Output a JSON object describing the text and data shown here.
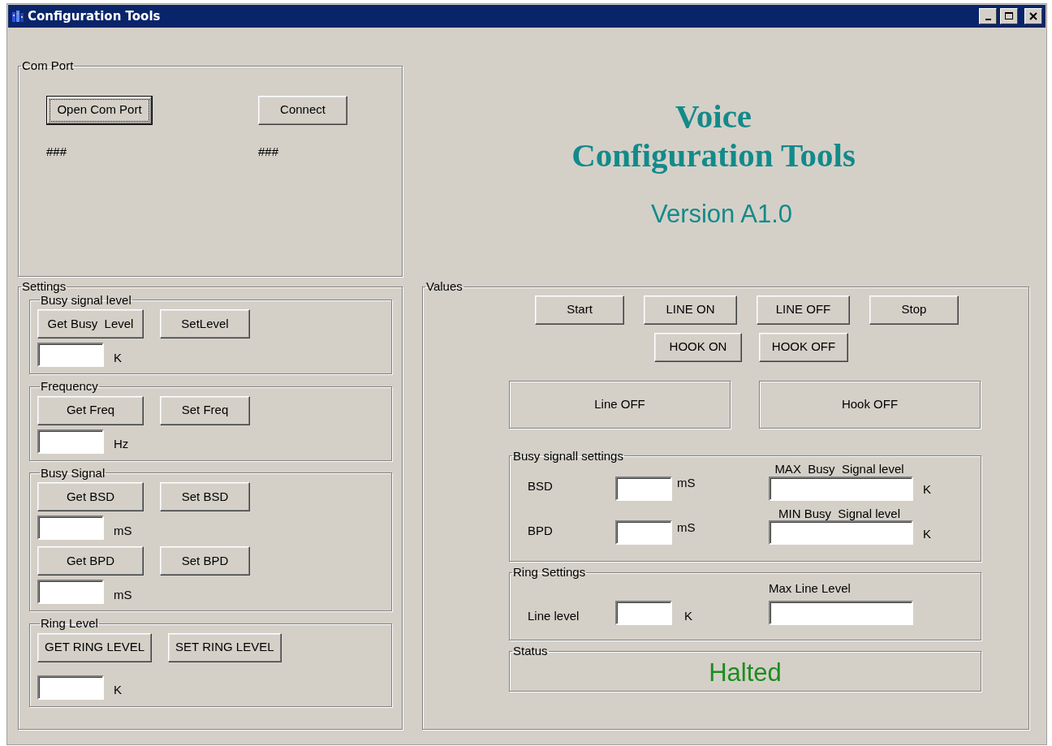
{
  "window": {
    "title": "Configuration Tools"
  },
  "com_port": {
    "title": "Com Port",
    "buttons": [
      {
        "label": "Open Com Port",
        "focused": true
      },
      {
        "label": "Connect",
        "focused": false
      }
    ],
    "statuses": [
      "###",
      "###"
    ]
  },
  "settings": {
    "title": "Settings",
    "groups": [
      {
        "title": "Busy signal level",
        "rows": [
          {
            "buttons": [
              "Get Busy  Level",
              "SetLevel"
            ],
            "unit": "K"
          }
        ]
      },
      {
        "title": "Frequency",
        "rows": [
          {
            "buttons": [
              "Get Freq",
              "Set Freq"
            ],
            "unit": "Hz"
          }
        ]
      },
      {
        "title": "Busy Signal",
        "rows": [
          {
            "buttons": [
              "Get BSD",
              "Set BSD"
            ],
            "unit": "mS"
          },
          {
            "buttons": [
              "Get BPD",
              "Set BPD"
            ],
            "unit": "mS"
          }
        ]
      },
      {
        "title": "Ring Level",
        "rows": [
          {
            "buttons": [
              "GET RING LEVEL",
              "SET RING LEVEL"
            ],
            "unit": "K"
          }
        ]
      }
    ]
  },
  "banner": {
    "title_lines": [
      "Voice",
      "Configuration Tools"
    ],
    "version": "Version A1.0"
  },
  "values": {
    "title": "Values",
    "button_rows": [
      [
        "Start",
        "LINE ON",
        "LINE OFF",
        "Stop"
      ],
      [
        "HOOK ON",
        "HOOK OFF"
      ]
    ],
    "indicators": [
      "Line OFF",
      "Hook OFF"
    ],
    "busy_settings": {
      "title": "Busy signall settings",
      "rows": [
        {
          "label": "BSD",
          "unit": "mS",
          "level_label": "MAX  Busy  Signal level",
          "level_unit": "K"
        },
        {
          "label": "BPD",
          "unit": "mS",
          "level_label": "MIN Busy  Signal level",
          "level_unit": "K"
        }
      ]
    },
    "ring_settings": {
      "title": "Ring Settings",
      "label": "Line level",
      "unit": "K",
      "max_label": "Max Line Level"
    },
    "status": {
      "title": "Status",
      "text": "Halted"
    }
  }
}
